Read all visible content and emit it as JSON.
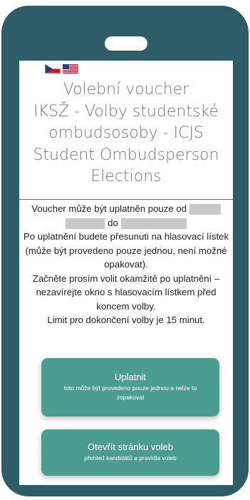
{
  "languages": {
    "czech_icon": "czech-flag-icon",
    "english_icon": "us-flag-icon"
  },
  "title": "Volební voucher\nIKSŽ - Volby studentské ombudsosoby - ICJS Student Ombudsperson Elections",
  "info": {
    "line1": "Voucher může být uplatněn pouze od",
    "line1_to": "do",
    "line2": "Po uplatnění budete přesunuti na hlasovací lístek (může být provedeno pouze jednou, není možné opakovat).",
    "line3": "Začněte prosím volit okamžitě po uplatnění – nezavírejte okno s hlasovacím lístkem před koncem volby.",
    "line4": "Limit pro dokončení volby je 15 minut."
  },
  "redeem_button": {
    "label": "Uplatnit",
    "sub": "toto může být provedeno pouze jednou a nelze to zopakovat"
  },
  "election_page_button": {
    "label": "Otevřít stránku voleb",
    "sub": "přehled kandidátů a pravidla voleb"
  },
  "colors": {
    "phone_frame": "#2e5c67",
    "button": "#4a9d8f",
    "redaction": "#c8c8c8"
  }
}
